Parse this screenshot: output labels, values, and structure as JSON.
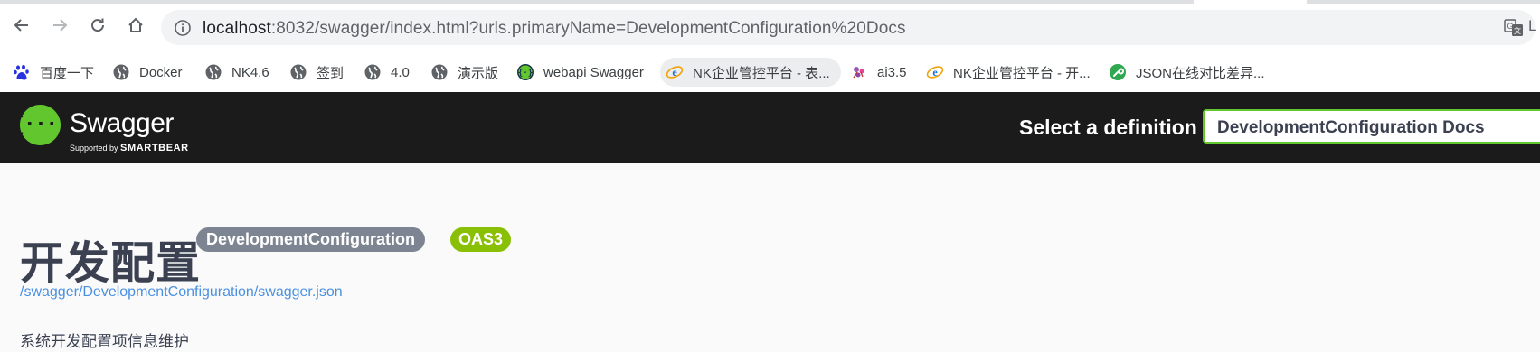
{
  "browser": {
    "url_host": "localhost",
    "url_rest": ":8032/swagger/index.html?urls.primaryName=DevelopmentConfiguration%20Docs",
    "edge_text": "L",
    "icons": [
      "back-icon",
      "forward-icon",
      "reload-icon",
      "home-icon",
      "info-icon",
      "translate-icon"
    ]
  },
  "bookmarks": [
    {
      "label": "百度一下",
      "icon": "baidu-icon"
    },
    {
      "label": "Docker",
      "icon": "globe-icon"
    },
    {
      "label": "NK4.6",
      "icon": "globe-icon"
    },
    {
      "label": "签到",
      "icon": "globe-icon"
    },
    {
      "label": "4.0",
      "icon": "globe-icon"
    },
    {
      "label": "演示版",
      "icon": "globe-icon"
    },
    {
      "label": "webapi Swagger",
      "icon": "swagger-icon"
    },
    {
      "label": "NK企业管控平台 - 表...",
      "icon": "ie-icon"
    },
    {
      "label": "ai3.5",
      "icon": "ai-icon"
    },
    {
      "label": "NK企业管控平台 - 开...",
      "icon": "ie-icon"
    },
    {
      "label": "JSON在线对比差异...",
      "icon": "wrench-icon"
    }
  ],
  "topbar": {
    "logo_glyph": "{···}",
    "logo_text": "Swagger",
    "logo_sub_prefix": "Supported by ",
    "logo_sub_brand": "SMARTBEAR",
    "select_label": "Select a definition",
    "selected_definition": "DevelopmentConfiguration Docs"
  },
  "info": {
    "title": "开发配置",
    "version_badge": "DevelopmentConfiguration",
    "oas_badge": "OAS3",
    "spec_link": "/swagger/DevelopmentConfiguration/swagger.json",
    "description": "系统开发配置项信息维护"
  },
  "colors": {
    "topbar_bg": "#1b1b1b",
    "swagger_green": "#62c72e",
    "oas_badge": "#89bf04",
    "version_badge": "#7d8492",
    "link": "#4990e2",
    "title": "#3b4151"
  }
}
